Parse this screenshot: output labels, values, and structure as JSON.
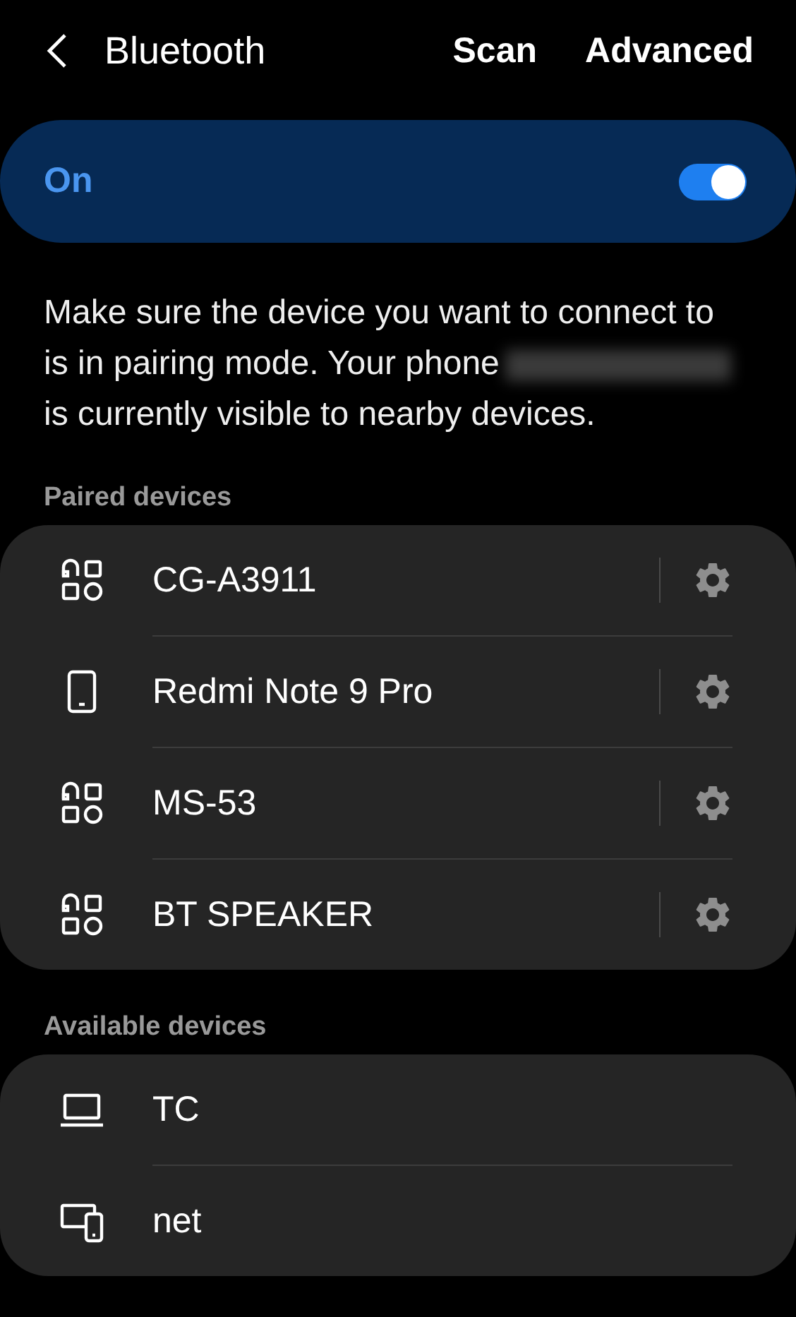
{
  "header": {
    "title": "Bluetooth",
    "actions": [
      "Scan",
      "Advanced"
    ]
  },
  "master_switch": {
    "label": "On",
    "on": true
  },
  "description": {
    "before": "Make sure the device you want to connect to is in pairing mode. Your phone",
    "name_redacted": true,
    "after": "is currently visible to nearby devices."
  },
  "sections": [
    {
      "title": "Paired devices",
      "devices": [
        {
          "name": "CG-A3911",
          "kind": "audio",
          "settings": true
        },
        {
          "name": "Redmi Note 9 Pro",
          "kind": "phone",
          "settings": true
        },
        {
          "name": "MS-53",
          "kind": "audio",
          "settings": true
        },
        {
          "name": "BT SPEAKER",
          "kind": "audio",
          "settings": true
        }
      ]
    },
    {
      "title": "Available devices",
      "devices": [
        {
          "name": "TC",
          "kind": "laptop",
          "settings": false
        },
        {
          "name": "net",
          "kind": "devices",
          "settings": false
        }
      ]
    }
  ]
}
